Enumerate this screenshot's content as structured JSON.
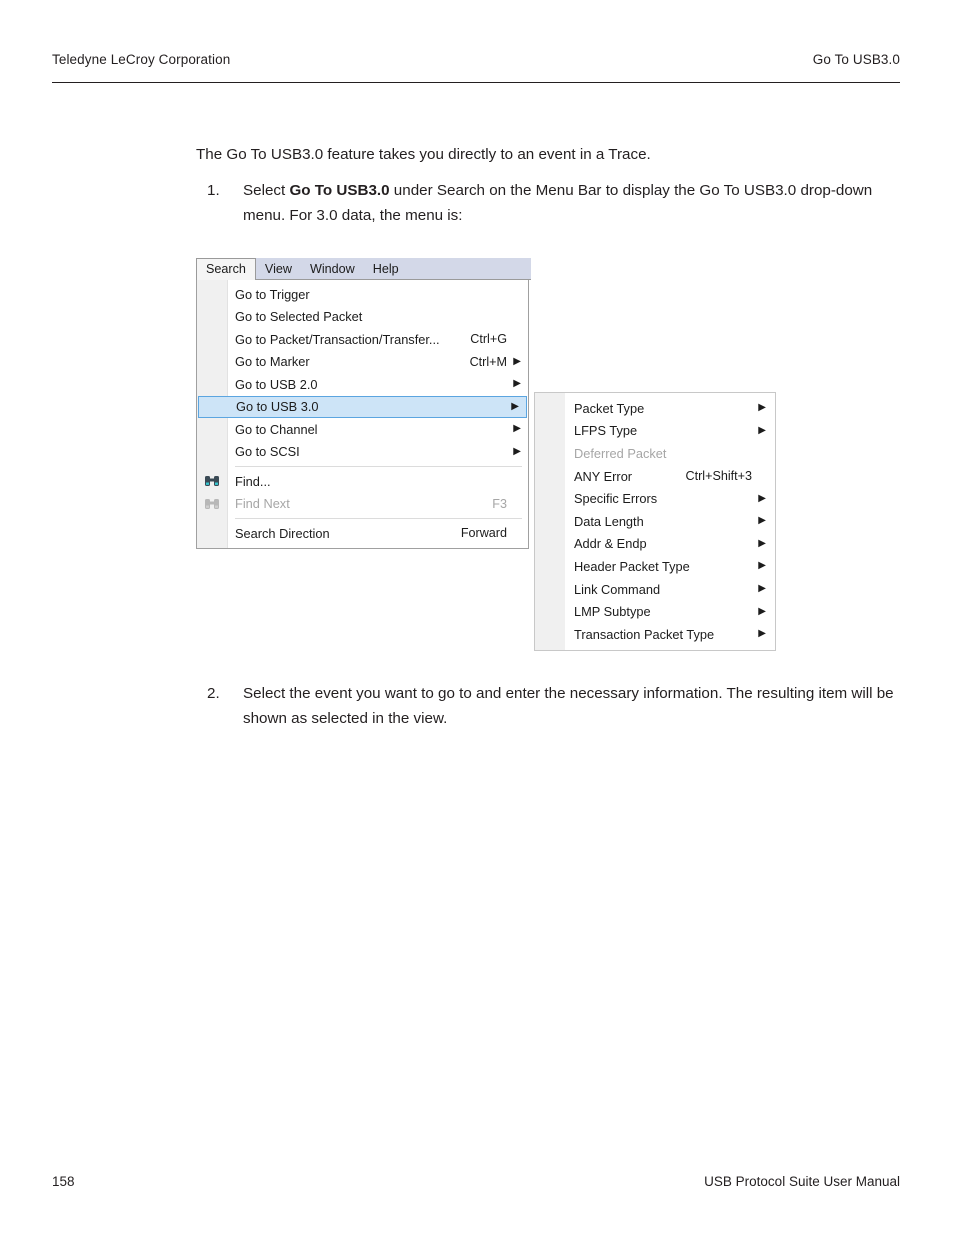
{
  "page_header": {
    "left": "Teledyne LeCroy Corporation",
    "right": "Go To USB3.0"
  },
  "body": {
    "intro": "The Go To USB3.0 feature takes you directly to an event in a Trace.",
    "step1": {
      "number": "1.",
      "before_bold": "Select ",
      "bold": "Go To USB3.0",
      "after_bold": " under Search on the Menu Bar to display the Go To USB3.0 drop-down menu. For 3.0 data, the menu is:"
    },
    "step2": {
      "number": "2.",
      "text": "Select the event you want to go to and enter the necessary information. The resulting item will be shown as selected in the view."
    }
  },
  "menu_screenshot": {
    "menubar": [
      {
        "label": "Search",
        "active": true
      },
      {
        "label": "View",
        "active": false
      },
      {
        "label": "Window",
        "active": false
      },
      {
        "label": "Help",
        "active": false
      }
    ],
    "dropdown_items": [
      {
        "label": "Go to Trigger",
        "accel": "",
        "arrow": false,
        "disabled": false,
        "selected": false,
        "icon": ""
      },
      {
        "label": "Go to Selected Packet",
        "accel": "",
        "arrow": false,
        "disabled": false,
        "selected": false,
        "icon": ""
      },
      {
        "label": "Go to Packet/Transaction/Transfer...",
        "accel": "Ctrl+G",
        "arrow": false,
        "disabled": false,
        "selected": false,
        "icon": ""
      },
      {
        "label": "Go to Marker",
        "accel": "Ctrl+M",
        "arrow": true,
        "disabled": false,
        "selected": false,
        "icon": ""
      },
      {
        "label": "Go to USB 2.0",
        "accel": "",
        "arrow": true,
        "disabled": false,
        "selected": false,
        "icon": ""
      },
      {
        "label": "Go to USB 3.0",
        "accel": "",
        "arrow": true,
        "disabled": false,
        "selected": true,
        "icon": ""
      },
      {
        "label": "Go to Channel",
        "accel": "",
        "arrow": true,
        "disabled": false,
        "selected": false,
        "icon": ""
      },
      {
        "label": "Go to SCSI",
        "accel": "",
        "arrow": true,
        "disabled": false,
        "selected": false,
        "icon": ""
      },
      {
        "separator": true
      },
      {
        "label": "Find...",
        "accel": "",
        "arrow": false,
        "disabled": false,
        "selected": false,
        "icon": "binoculars-icon"
      },
      {
        "label": "Find Next",
        "accel": "F3",
        "arrow": false,
        "disabled": true,
        "selected": false,
        "icon": "binoculars-next-icon"
      },
      {
        "separator": true
      },
      {
        "label": "Search Direction",
        "accel": "Forward",
        "arrow": false,
        "disabled": false,
        "selected": false,
        "icon": ""
      }
    ],
    "submenu_items": [
      {
        "label": "Packet Type",
        "accel": "",
        "arrow": true,
        "disabled": false
      },
      {
        "label": "LFPS Type",
        "accel": "",
        "arrow": true,
        "disabled": false
      },
      {
        "label": "Deferred Packet",
        "accel": "",
        "arrow": false,
        "disabled": true
      },
      {
        "label": "ANY Error",
        "accel": "Ctrl+Shift+3",
        "arrow": false,
        "disabled": false
      },
      {
        "label": "Specific Errors",
        "accel": "",
        "arrow": true,
        "disabled": false
      },
      {
        "label": "Data Length",
        "accel": "",
        "arrow": true,
        "disabled": false
      },
      {
        "label": "Addr & Endp",
        "accel": "",
        "arrow": true,
        "disabled": false
      },
      {
        "label": "Header Packet Type",
        "accel": "",
        "arrow": true,
        "disabled": false
      },
      {
        "label": "Link Command",
        "accel": "",
        "arrow": true,
        "disabled": false
      },
      {
        "label": "LMP Subtype",
        "accel": "",
        "arrow": true,
        "disabled": false
      },
      {
        "label": "Transaction Packet Type",
        "accel": "",
        "arrow": true,
        "disabled": false
      }
    ],
    "colors": {
      "menubar_bg": "#d3d8e8",
      "selection_bg": "#cde4f7",
      "selection_border": "#5ba5e0",
      "gutter_bg": "#f0f0f0",
      "menu_bg": "#ffffff",
      "disabled_text": "#a6a6a6"
    }
  },
  "page_footer": {
    "page_number": "158",
    "manual_title": "USB Protocol Suite User Manual"
  }
}
